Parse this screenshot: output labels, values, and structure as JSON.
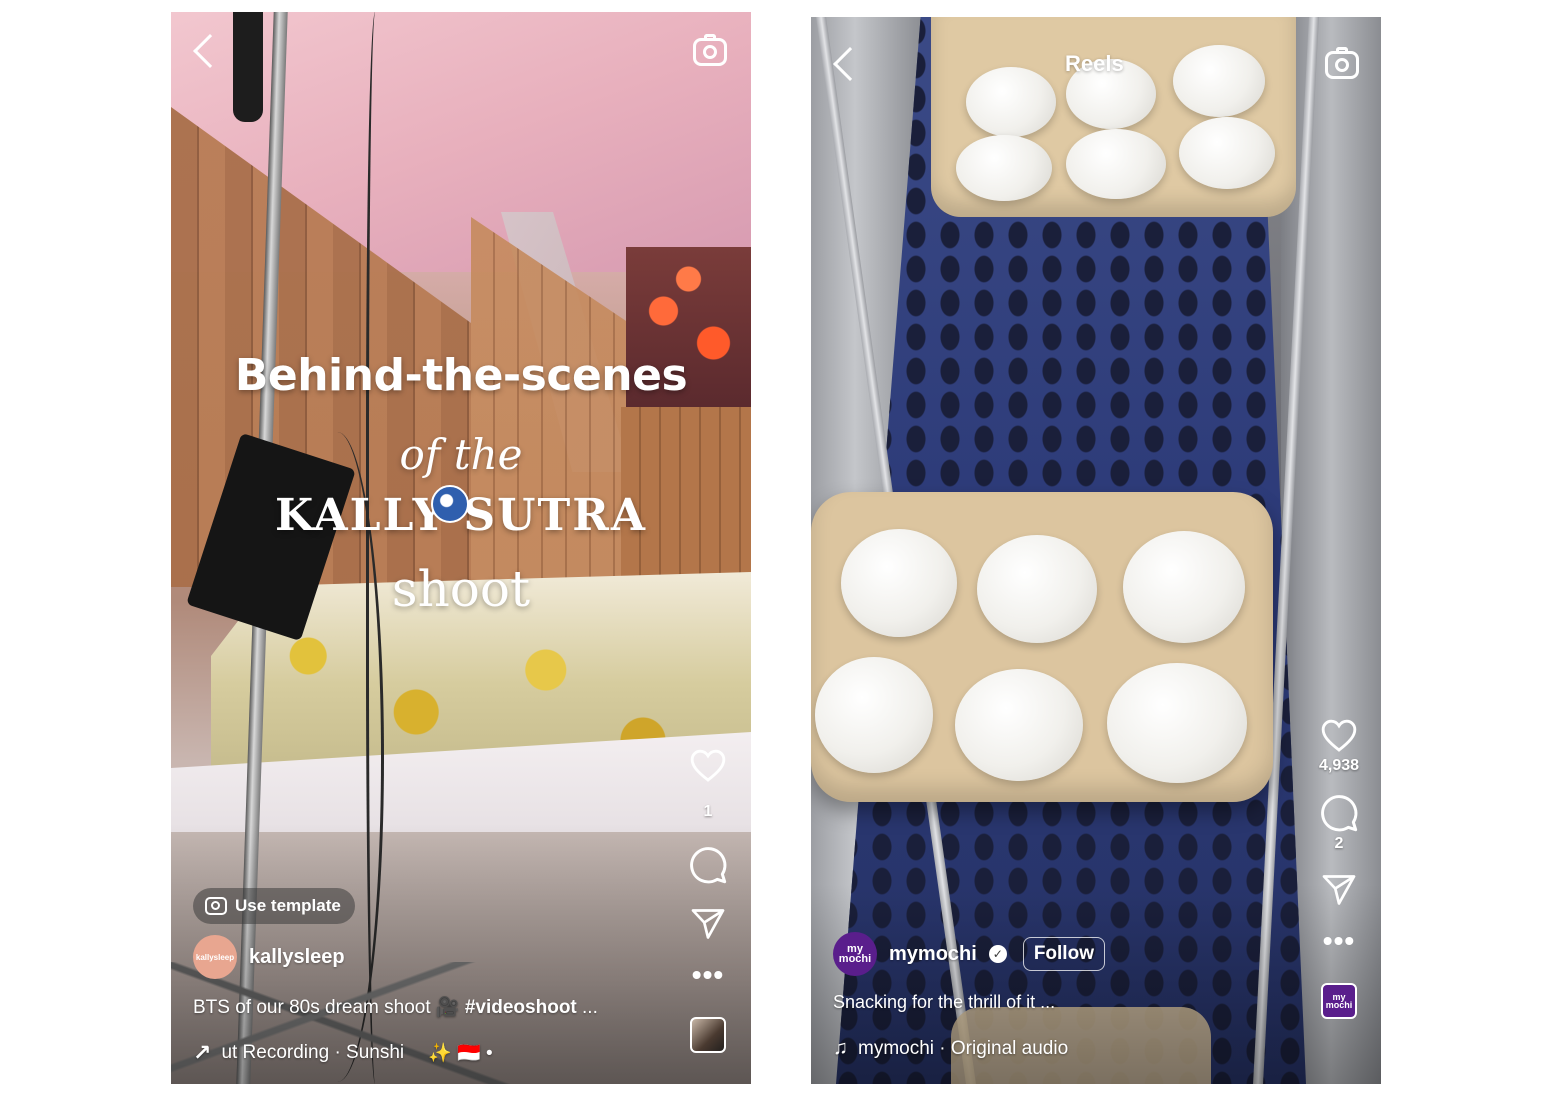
{
  "left_reel": {
    "overlay": {
      "line1": "Behind-the-scenes",
      "line2": "of the",
      "line3": "KALLY SUTRA",
      "line4": "shoot"
    },
    "template_button": "Use template",
    "like_count": "1",
    "author": {
      "avatar_text": "kallysleep",
      "username": "kallysleep"
    },
    "caption": {
      "text": "BTS of our 80s dream shoot 🎥 ",
      "hashtag": "#videoshoot",
      "more": " ..."
    },
    "audio": {
      "text": "ut Recording · Sunshi",
      "extras": "✨ 🇮🇩 •"
    },
    "icons": [
      "chevron-left-icon",
      "camera-icon",
      "heart-icon",
      "comment-icon",
      "send-icon",
      "more-icon"
    ]
  },
  "right_reel": {
    "header": {
      "title": "Reels"
    },
    "like_count": "4,938",
    "comment_count": "2",
    "author": {
      "avatar_text": "my mochi",
      "username": "mymochi",
      "verified": true,
      "follow_label": "Follow"
    },
    "caption": "Snacking for the thrill of it ...",
    "audio": {
      "text": "mymochi · Original audio",
      "thumb_text": "my mochi"
    },
    "colors": {
      "brand": "#5a1e8c"
    },
    "icons": [
      "chevron-left-icon",
      "camera-icon",
      "heart-icon",
      "comment-icon",
      "send-icon",
      "more-icon",
      "music-note-icon",
      "verified-icon"
    ]
  }
}
